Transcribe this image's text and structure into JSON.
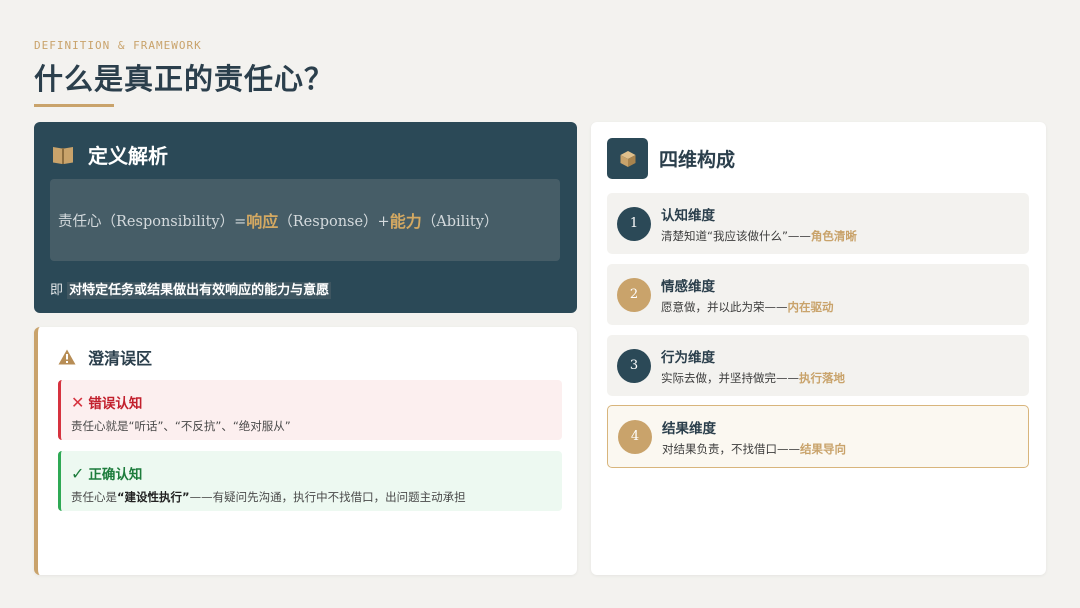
{
  "header": {
    "eyebrow": "DEFINITION & FRAMEWORK",
    "title": "什么是真正的责任心？"
  },
  "definition": {
    "title": "定义解析",
    "icon": "book-icon",
    "formula": {
      "part1": "责任心（Responsibility）= ",
      "term1": "响应",
      "part2": "（Response）+ ",
      "term2": "能力",
      "part3": "（Ability）"
    },
    "note_prefix": "即",
    "note_highlight": "对特定任务或结果做出有效响应的能力与意愿"
  },
  "misconceptions": {
    "title": "澄清误区",
    "icon": "warning-icon",
    "wrong": {
      "mark": "✕",
      "label": "错误认知",
      "text": "责任心就是“听话”、“不反抗”、“绝对服从”"
    },
    "right": {
      "mark": "✓",
      "label": "正确认知",
      "text_prefix": "责任心是",
      "text_bold": "“建设性执行”",
      "text_suffix": "——有疑问先沟通，执行中不找借口，出问题主动承担"
    }
  },
  "dimensions": {
    "title": "四维构成",
    "icon": "cube-icon",
    "items": [
      {
        "num": "1",
        "name": "认知维度",
        "desc": "清楚知道“我应该做什么”——",
        "accent": "角色清晰"
      },
      {
        "num": "2",
        "name": "情感维度",
        "desc": "愿意做，并以此为荣——",
        "accent": "内在驱动"
      },
      {
        "num": "3",
        "name": "行为维度",
        "desc": "实际去做，并坚持做完——",
        "accent": "执行落地"
      },
      {
        "num": "4",
        "name": "结果维度",
        "desc": "对结果负责，不找借口——",
        "accent": "结果导向"
      }
    ]
  },
  "colors": {
    "navy": "#2b4957",
    "gold": "#c9a36b",
    "error": "#d6333f",
    "success": "#2fa955",
    "background": "#f3f2ef"
  }
}
